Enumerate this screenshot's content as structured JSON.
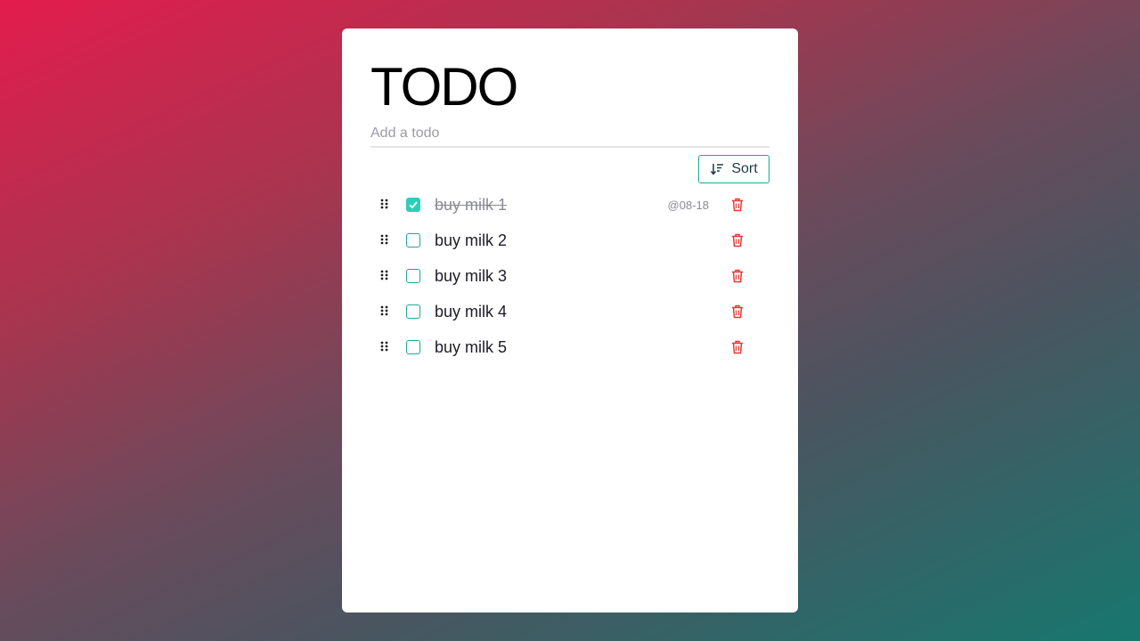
{
  "app": {
    "title": "TODO"
  },
  "add_input": {
    "placeholder": "Add a todo",
    "value": ""
  },
  "toolbar": {
    "sort_label": "Sort",
    "sort_icon": "sort-descending-icon"
  },
  "todos": [
    {
      "label": "buy milk 1",
      "done": true,
      "date": "@08-18"
    },
    {
      "label": "buy milk 2",
      "done": false,
      "date": ""
    },
    {
      "label": "buy milk 3",
      "done": false,
      "date": ""
    },
    {
      "label": "buy milk 4",
      "done": false,
      "date": ""
    },
    {
      "label": "buy milk 5",
      "done": false,
      "date": ""
    }
  ],
  "colors": {
    "accent": "#1fa59a",
    "checked_fill": "#2dcdbb",
    "delete": "#e53935",
    "text": "#1c1c28",
    "muted": "#8a8a96"
  },
  "icons": {
    "drag": "drag-handle-icon",
    "delete": "trash-icon",
    "check": "checkmark-icon"
  }
}
